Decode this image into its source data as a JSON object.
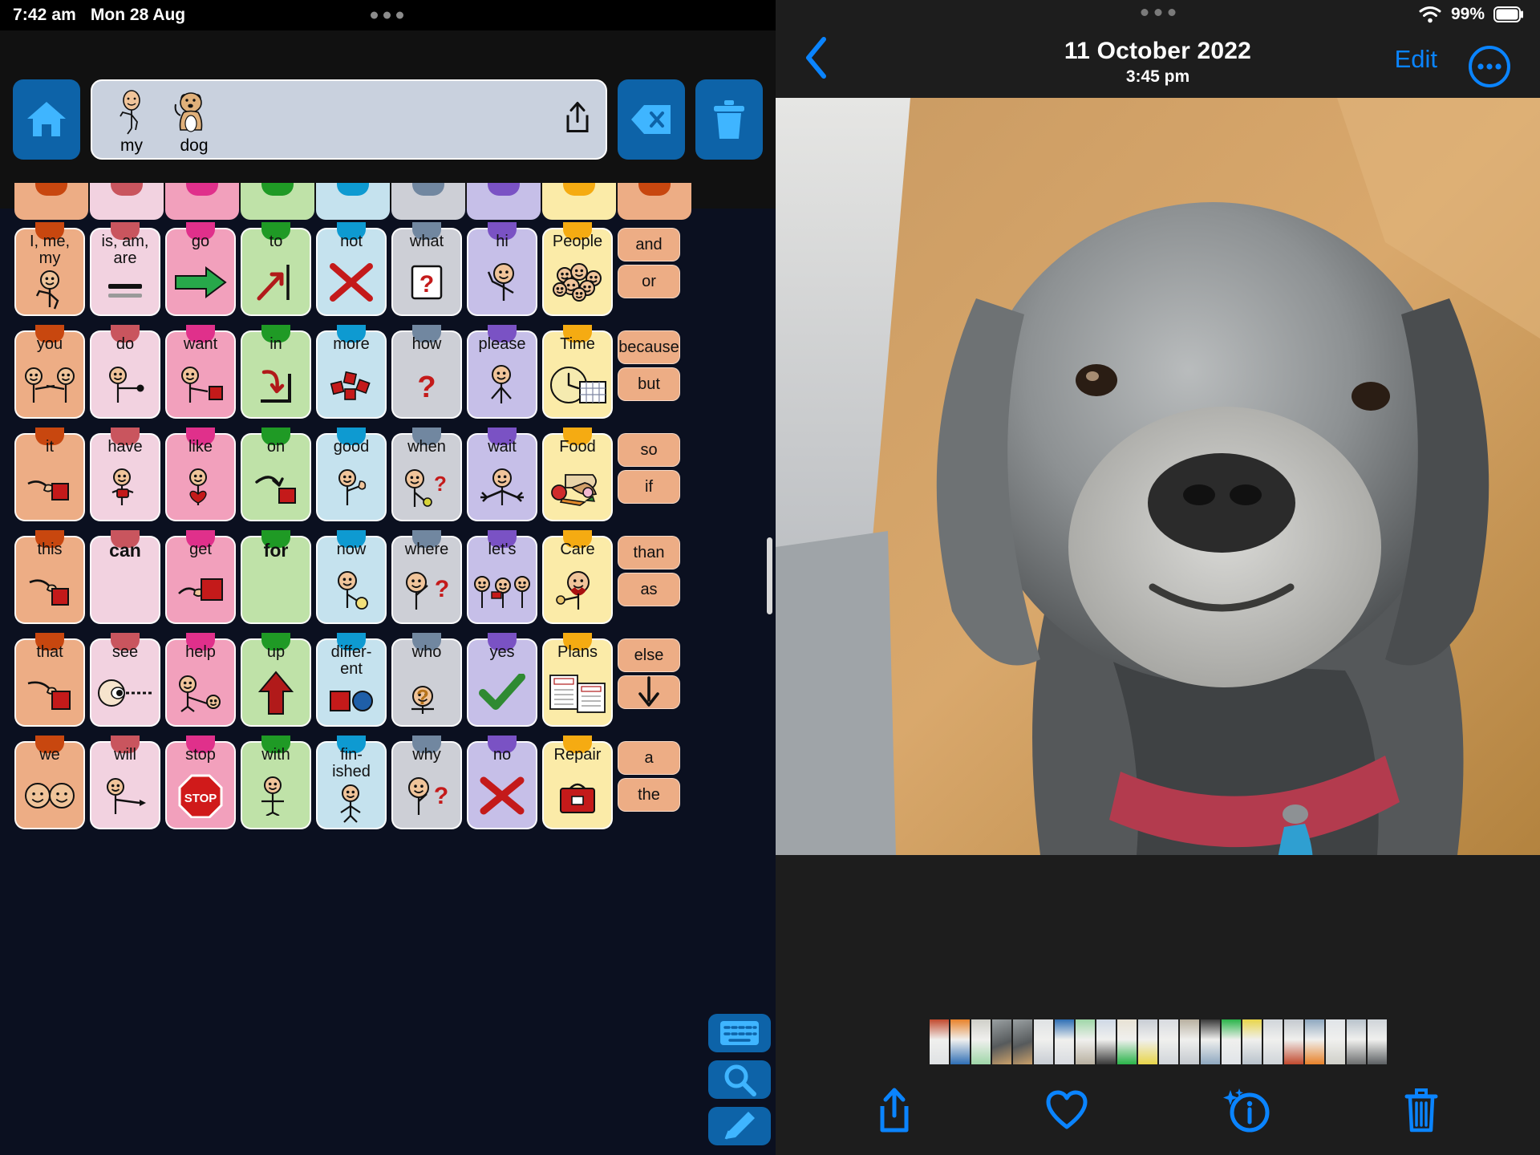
{
  "aac": {
    "status": {
      "time": "7:42 am",
      "date": "Mon 28 Aug"
    },
    "toolbar": {
      "home_label": "home-button",
      "share_label": "share-message",
      "backspace_label": "backspace",
      "clear_label": "clear-message"
    },
    "message": {
      "words": [
        {
          "label": "my",
          "icon": "person-pointing-self"
        },
        {
          "label": "dog",
          "icon": "dog"
        }
      ]
    },
    "peek_row": [
      {
        "color": "#edad85",
        "tab": "#c8470f"
      },
      {
        "color": "#f2d2e0",
        "tab": "#c9555e"
      },
      {
        "color": "#f2a0bc",
        "tab": "#e0308b"
      },
      {
        "color": "#bfe2a8",
        "tab": "#1f9a25"
      },
      {
        "color": "#c5e2ee",
        "tab": "#0e9ad1"
      },
      {
        "color": "#cdcfd6",
        "tab": "#7187a0"
      },
      {
        "color": "#c6bfe8",
        "tab": "#7a52c4"
      },
      {
        "color": "#fbeba8",
        "tab": "#f5ab12"
      },
      {
        "color": "#edad85",
        "tab": "#c8470f"
      }
    ],
    "grid_rows": [
      [
        {
          "label": "I, me,\nmy",
          "bg": "#edad85",
          "tab": "#c8470f",
          "icon": "person-self"
        },
        {
          "label": "is, am,\nare",
          "bg": "#f2d2e0",
          "tab": "#c9555e",
          "icon": "equals-lines"
        },
        {
          "label": "go",
          "bg": "#f2a0bc",
          "tab": "#e0308b",
          "icon": "green-arrow-right"
        },
        {
          "label": "to",
          "bg": "#bfe2a8",
          "tab": "#1f9a25",
          "icon": "red-arrow-to-line"
        },
        {
          "label": "not",
          "bg": "#c5e2ee",
          "tab": "#0e9ad1",
          "icon": "red-cross"
        },
        {
          "label": "what",
          "bg": "#cdcfd6",
          "tab": "#7187a0",
          "icon": "question-card"
        },
        {
          "label": "hi",
          "bg": "#c6bfe8",
          "tab": "#7a52c4",
          "icon": "person-waving"
        },
        {
          "label": "People",
          "bg": "#fbeba8",
          "tab": "#f5ab12",
          "icon": "group-of-faces"
        }
      ],
      [
        {
          "label": "you",
          "bg": "#edad85",
          "tab": "#c8470f",
          "icon": "two-people-pointing"
        },
        {
          "label": "do",
          "bg": "#f2d2e0",
          "tab": "#c9555e",
          "icon": "person-action"
        },
        {
          "label": "want",
          "bg": "#f2a0bc",
          "tab": "#e0308b",
          "icon": "person-reaching-red-block"
        },
        {
          "label": "in",
          "bg": "#bfe2a8",
          "tab": "#1f9a25",
          "icon": "arrow-into-box"
        },
        {
          "label": "more",
          "bg": "#c5e2ee",
          "tab": "#0e9ad1",
          "icon": "red-blocks-cluster"
        },
        {
          "label": "how",
          "bg": "#cdcfd6",
          "tab": "#7187a0",
          "icon": "red-question-arrow"
        },
        {
          "label": "please",
          "bg": "#c6bfe8",
          "tab": "#7a52c4",
          "icon": "person-pleading"
        },
        {
          "label": "Time",
          "bg": "#fbeba8",
          "tab": "#f5ab12",
          "icon": "clock-and-calendar"
        }
      ],
      [
        {
          "label": "it",
          "bg": "#edad85",
          "tab": "#c8470f",
          "icon": "hand-pointing-red-block"
        },
        {
          "label": "have",
          "bg": "#f2d2e0",
          "tab": "#c9555e",
          "icon": "person-holding-red"
        },
        {
          "label": "like",
          "bg": "#f2a0bc",
          "tab": "#e0308b",
          "icon": "person-heart"
        },
        {
          "label": "on",
          "bg": "#bfe2a8",
          "tab": "#1f9a25",
          "icon": "arrow-onto-block"
        },
        {
          "label": "good",
          "bg": "#c5e2ee",
          "tab": "#0e9ad1",
          "icon": "person-thumbs-up"
        },
        {
          "label": "when",
          "bg": "#cdcfd6",
          "tab": "#7187a0",
          "icon": "person-question-clock"
        },
        {
          "label": "wait",
          "bg": "#c6bfe8",
          "tab": "#7a52c4",
          "icon": "person-hands-up"
        },
        {
          "label": "Food",
          "bg": "#fbeba8",
          "tab": "#f5ab12",
          "icon": "bread-apple-carrot"
        }
      ],
      [
        {
          "label": "this",
          "bg": "#edad85",
          "tab": "#c8470f",
          "icon": "person-pointing-red-block"
        },
        {
          "label": "can",
          "bg": "#f2d2e0",
          "tab": "#c9555e",
          "icon": "",
          "bold": true
        },
        {
          "label": "get",
          "bg": "#f2a0bc",
          "tab": "#e0308b",
          "icon": "hand-grabbing-red-block"
        },
        {
          "label": "for",
          "bg": "#bfe2a8",
          "tab": "#1f9a25",
          "icon": "",
          "bold": true
        },
        {
          "label": "now",
          "bg": "#c5e2ee",
          "tab": "#0e9ad1",
          "icon": "person-clock"
        },
        {
          "label": "where",
          "bg": "#cdcfd6",
          "tab": "#7187a0",
          "icon": "person-looking-question"
        },
        {
          "label": "let's",
          "bg": "#c6bfe8",
          "tab": "#7a52c4",
          "icon": "three-people-passing"
        },
        {
          "label": "Care",
          "bg": "#fbeba8",
          "tab": "#f5ab12",
          "icon": "person-eating"
        }
      ],
      [
        {
          "label": "that",
          "bg": "#edad85",
          "tab": "#c8470f",
          "icon": "hand-pointing-red-square"
        },
        {
          "label": "see",
          "bg": "#f2d2e0",
          "tab": "#c9555e",
          "icon": "eye-with-sightline"
        },
        {
          "label": "help",
          "bg": "#f2a0bc",
          "tab": "#e0308b",
          "icon": "person-helping-person"
        },
        {
          "label": "up",
          "bg": "#bfe2a8",
          "tab": "#1f9a25",
          "icon": "red-arrow-up"
        },
        {
          "label": "differ-\nent",
          "bg": "#c5e2ee",
          "tab": "#0e9ad1",
          "icon": "red-square-blue-circle"
        },
        {
          "label": "who",
          "bg": "#cdcfd6",
          "tab": "#7187a0",
          "icon": "person-question-mark"
        },
        {
          "label": "yes",
          "bg": "#c6bfe8",
          "tab": "#7a52c4",
          "icon": "green-check"
        },
        {
          "label": "Plans",
          "bg": "#fbeba8",
          "tab": "#f5ab12",
          "icon": "plan-documents"
        }
      ],
      [
        {
          "label": "we",
          "bg": "#edad85",
          "tab": "#c8470f",
          "icon": "two-faces"
        },
        {
          "label": "will",
          "bg": "#f2d2e0",
          "tab": "#c9555e",
          "icon": "person-pointing-forward"
        },
        {
          "label": "stop",
          "bg": "#f2a0bc",
          "tab": "#e0308b",
          "icon": "stop-sign"
        },
        {
          "label": "with",
          "bg": "#bfe2a8",
          "tab": "#1f9a25",
          "icon": "two-shapes-together"
        },
        {
          "label": "fin-\nished",
          "bg": "#c5e2ee",
          "tab": "#0e9ad1",
          "icon": "person-done"
        },
        {
          "label": "why",
          "bg": "#cdcfd6",
          "tab": "#7187a0",
          "icon": "person-thinking-question"
        },
        {
          "label": "no",
          "bg": "#c6bfe8",
          "tab": "#7a52c4",
          "icon": "red-cross-no"
        },
        {
          "label": "Repair",
          "bg": "#fbeba8",
          "tab": "#f5ab12",
          "icon": "toolbox-red"
        }
      ]
    ],
    "side_words": [
      [
        "and",
        "or"
      ],
      [
        "because",
        "but"
      ],
      [
        "so",
        "if"
      ],
      [
        "than",
        "as"
      ],
      [
        "else",
        "arrow-down"
      ],
      [
        "a",
        "the"
      ]
    ],
    "util_buttons": [
      {
        "name": "keyboard",
        "icon": "keyboard-icon"
      },
      {
        "name": "search",
        "icon": "search-icon"
      },
      {
        "name": "edit",
        "icon": "pencil-icon"
      }
    ]
  },
  "photos": {
    "status": {
      "battery_pct": "99%",
      "wifi": "wifi-icon"
    },
    "nav": {
      "back": "back-chevron",
      "date": "11 October 2022",
      "time": "3:45 pm",
      "edit_label": "Edit",
      "more_label": "more-options"
    },
    "photo_alt": "grey curly-haired dog sitting on wooden floor wearing red collar",
    "toolbar": [
      {
        "name": "share",
        "icon": "share-icon"
      },
      {
        "name": "favourite",
        "icon": "heart-icon"
      },
      {
        "name": "info",
        "icon": "info-sparkle-icon"
      },
      {
        "name": "delete",
        "icon": "trash-icon"
      }
    ],
    "filmstrip_count": 22
  },
  "colors": {
    "accent_blue": "#0a84ff",
    "aac_blue": "#0d63a8",
    "aac_bg": "#0b1020",
    "photos_bg": "#1d1d1d"
  }
}
